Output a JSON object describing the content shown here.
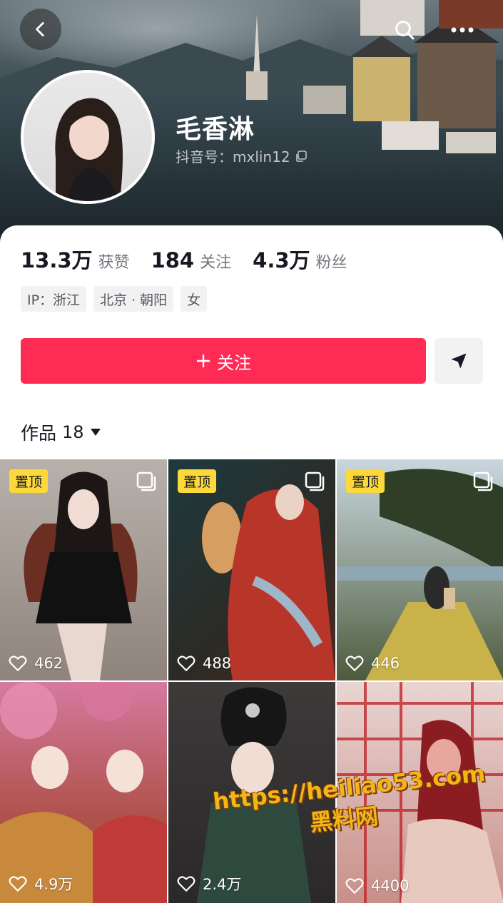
{
  "profile": {
    "name": "毛香淋",
    "uid_label": "抖音号：mxlin12"
  },
  "stats": [
    {
      "value": "13.3万",
      "label": "获赞"
    },
    {
      "value": "184",
      "label": "关注"
    },
    {
      "value": "4.3万",
      "label": "粉丝"
    }
  ],
  "tags": [
    "IP：浙江",
    "北京 · 朝阳",
    "女"
  ],
  "actions": {
    "follow_label": "关注"
  },
  "works": {
    "label": "作品",
    "count": "18"
  },
  "videos": [
    {
      "pinned": "置顶",
      "likes": "462",
      "multi": true
    },
    {
      "pinned": "置顶",
      "likes": "488",
      "multi": true
    },
    {
      "pinned": "置顶",
      "likes": "446",
      "multi": true
    },
    {
      "pinned": "",
      "likes": "4.9万",
      "multi": false
    },
    {
      "pinned": "",
      "likes": "2.4万",
      "multi": false
    },
    {
      "pinned": "",
      "likes": "4400",
      "multi": false
    }
  ],
  "watermark": {
    "url": "https://heiliao53.com",
    "name": "黑料网"
  },
  "colors": {
    "accent": "#fe2c55",
    "pin_badge": "#fdd83b"
  }
}
